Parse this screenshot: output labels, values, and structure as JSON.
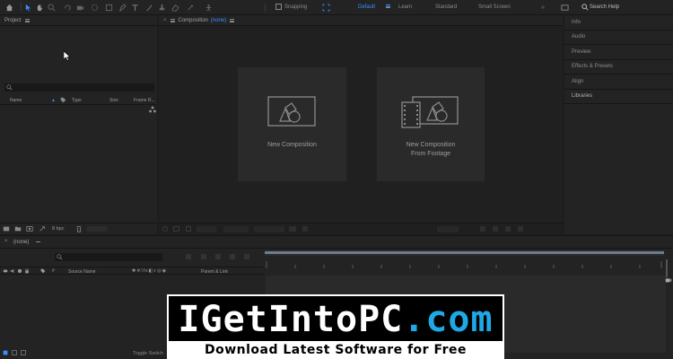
{
  "toolbar": {
    "snapping_label": "Snapping",
    "workspaces": [
      "Default",
      "Learn",
      "Standard",
      "Small Screen"
    ],
    "search_placeholder": "Search Help"
  },
  "project_panel": {
    "title": "Project",
    "columns": [
      "Name",
      "Type",
      "Size",
      "Frame R..."
    ],
    "bpc_label": "8 bpc"
  },
  "composition_panel": {
    "title": "Composition",
    "comp_name": "(none)",
    "new_composition_label": "New Composition",
    "new_from_footage_line1": "New Composition",
    "new_from_footage_line2": "From Footage"
  },
  "right_panels": {
    "items": [
      "Info",
      "Audio",
      "Preview",
      "Effects & Presets",
      "Align",
      "Libraries"
    ]
  },
  "timeline": {
    "tab_label": "(none)",
    "source_name_label": "Source Name",
    "parent_link_label": "Parent & Link",
    "toggle_label": "Toggle Switch"
  },
  "banner": {
    "title_part1": "IGetIntoPC",
    "title_part2": ".com",
    "subtitle": "Download Latest Software for Free"
  },
  "colors": {
    "accent": "#3c8fff",
    "banner_accent": "#1ea9e6"
  }
}
